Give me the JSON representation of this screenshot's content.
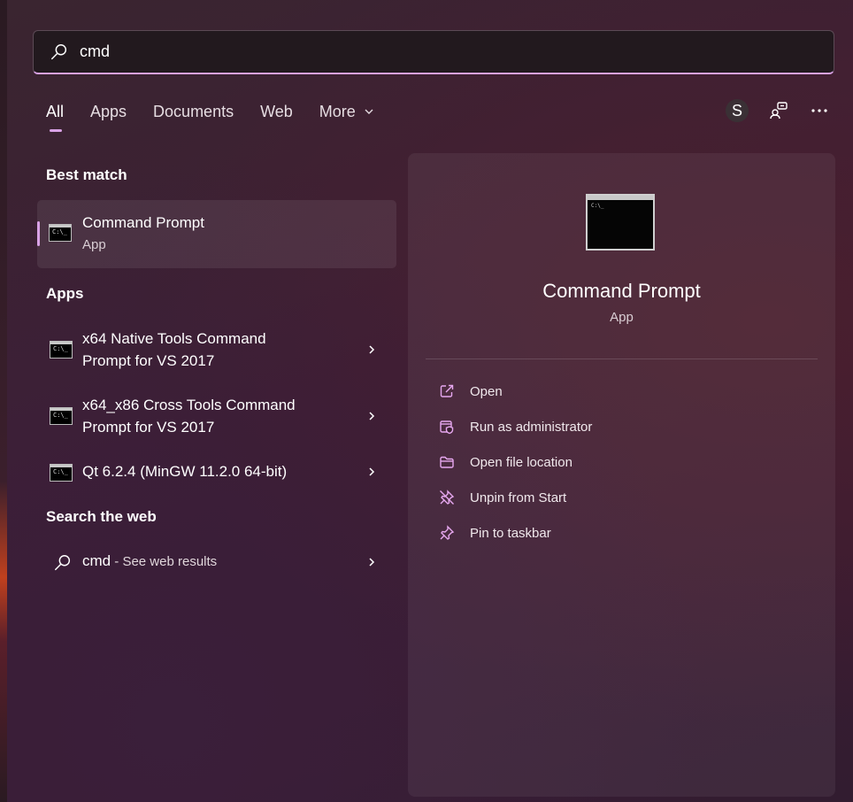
{
  "search": {
    "value": "cmd",
    "placeholder": ""
  },
  "tabs": [
    {
      "label": "All",
      "active": true
    },
    {
      "label": "Apps"
    },
    {
      "label": "Documents"
    },
    {
      "label": "Web"
    },
    {
      "label": "More"
    }
  ],
  "account": {
    "initial": "S"
  },
  "best_match": {
    "heading": "Best match",
    "title": "Command Prompt",
    "subtitle": "App"
  },
  "apps": {
    "heading": "Apps",
    "items": [
      {
        "line1": "x64 Native Tools Command",
        "line2": "Prompt for VS 2017"
      },
      {
        "line1": "x64_x86 Cross Tools Command",
        "line2": "Prompt for VS 2017"
      },
      {
        "line1": "Qt 6.2.4 (MinGW 11.2.0 64-bit)",
        "line2": ""
      }
    ]
  },
  "web": {
    "heading": "Search the web",
    "query": "cmd",
    "suffix": " - See web results"
  },
  "detail": {
    "title": "Command Prompt",
    "subtitle": "App",
    "actions": [
      {
        "label": "Open"
      },
      {
        "label": "Run as administrator"
      },
      {
        "label": "Open file location"
      },
      {
        "label": "Unpin from Start"
      },
      {
        "label": "Pin to taskbar"
      }
    ]
  },
  "icon_text": {
    "cmd_glyph": "C:\\_"
  },
  "colors": {
    "accent": "#d9a2e6"
  }
}
